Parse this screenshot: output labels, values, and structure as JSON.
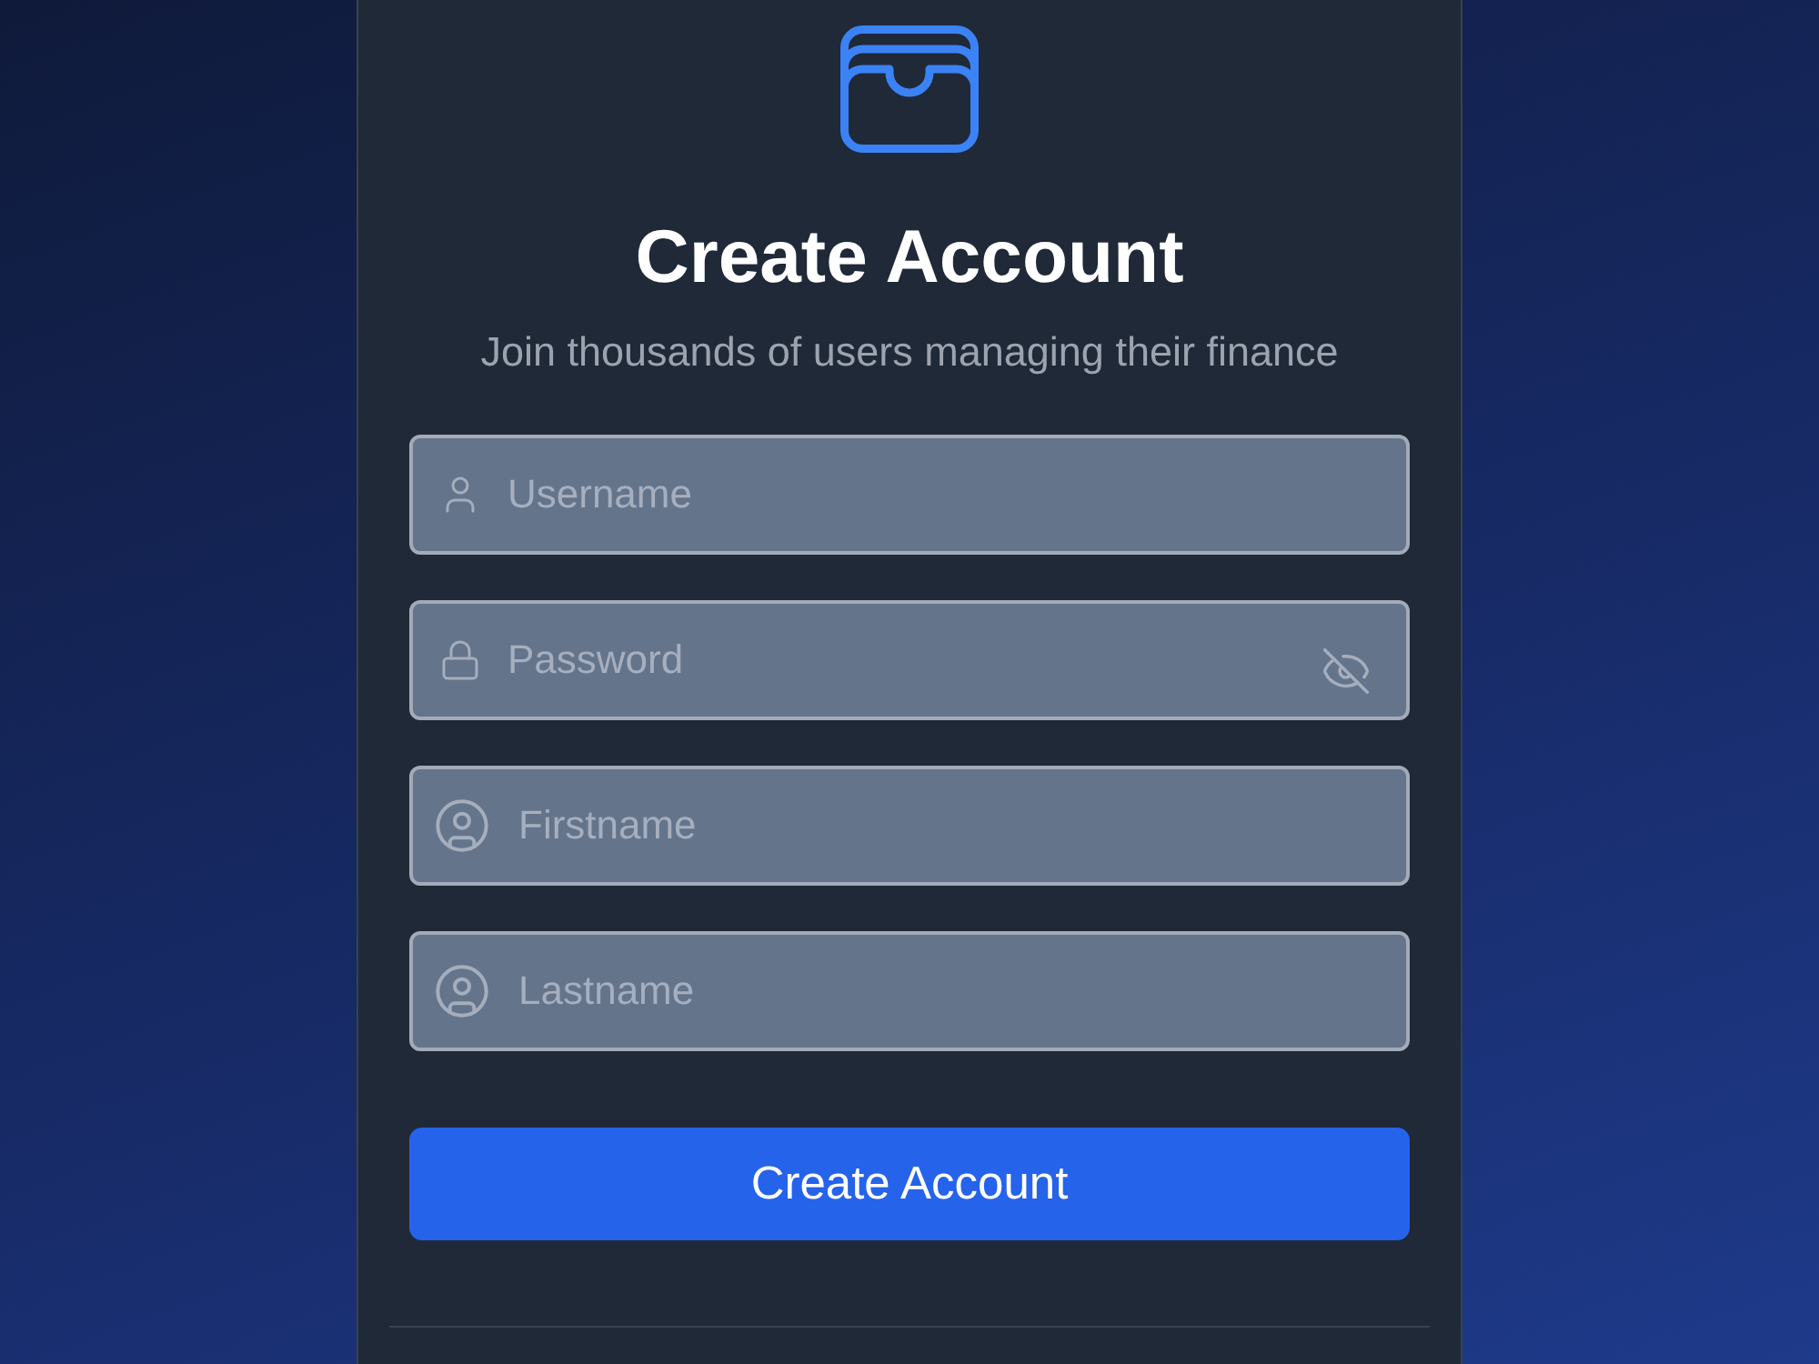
{
  "header": {
    "title": "Create Account",
    "subtitle": "Join thousands of users managing their finance"
  },
  "fields": [
    {
      "kind": "username",
      "placeholder": "Username"
    },
    {
      "kind": "password",
      "placeholder": "Password",
      "visible": false
    },
    {
      "kind": "name",
      "placeholder": "Firstname"
    },
    {
      "kind": "name",
      "placeholder": "Lastname"
    }
  ],
  "submit": {
    "label": "Create Account"
  }
}
